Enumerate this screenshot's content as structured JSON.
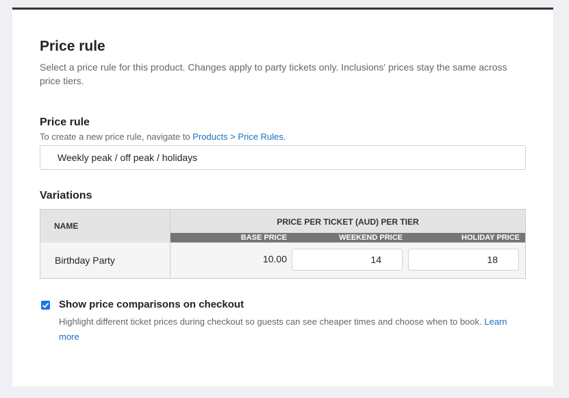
{
  "header": {
    "title": "Price rule",
    "description": "Select a price rule for this product. Changes apply to party tickets only. Inclusions' prices stay the same across price tiers."
  },
  "price_rule": {
    "label": "Price rule",
    "helper_text": "To create a new price rule, navigate to ",
    "helper_link": "Products > Price Rules",
    "helper_suffix": ".",
    "selected_value": "Weekly peak / off peak / holidays"
  },
  "variations": {
    "label": "Variations",
    "col_name": "NAME",
    "col_group": "PRICE PER TICKET (AUD) PER TIER",
    "subcols": [
      "BASE PRICE",
      "WEEKEND PRICE",
      "HOLIDAY PRICE"
    ],
    "rows": [
      {
        "name": "Birthday Party",
        "base_price": "10.00",
        "weekend_price": "14",
        "holiday_price": "18"
      }
    ]
  },
  "comparison": {
    "checked": true,
    "label": "Show price comparisons on checkout",
    "description": "Highlight different ticket prices during checkout so guests can see cheaper times and choose when to book. ",
    "link": "Learn more"
  },
  "colors": {
    "accent": "#1a73e8",
    "link": "#1a6fc4",
    "subheader": "#74767a"
  }
}
